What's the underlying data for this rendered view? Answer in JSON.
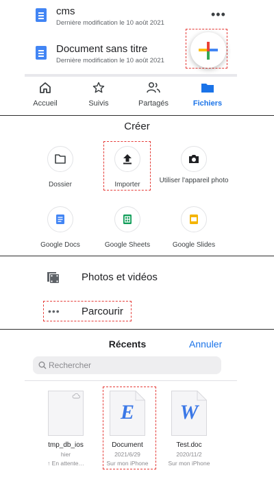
{
  "file_list": {
    "items": [
      {
        "title": "cms",
        "subtitle": "Dernière modification le 10 août 2021"
      },
      {
        "title": "Document sans titre",
        "subtitle": "Dernière modification le 10 août 2021"
      }
    ],
    "more_label": "•••",
    "fab_label": "+"
  },
  "bottom_nav": {
    "items": [
      {
        "label": "Accueil",
        "icon": "home-icon"
      },
      {
        "label": "Suivis",
        "icon": "star-icon"
      },
      {
        "label": "Partagés",
        "icon": "people-icon"
      },
      {
        "label": "Fichiers",
        "icon": "folder-icon"
      }
    ],
    "active_color": "#1a73e8"
  },
  "create_sheet": {
    "title": "Créer",
    "options": [
      {
        "label": "Dossier",
        "icon": "folder-outline-icon"
      },
      {
        "label": "Importer",
        "icon": "upload-icon"
      },
      {
        "label": "Utiliser l'appareil photo",
        "icon": "camera-icon"
      },
      {
        "label": "Google Docs",
        "icon": "google-docs-icon",
        "color": "#4285f4"
      },
      {
        "label": "Google Sheets",
        "icon": "google-sheets-icon",
        "color": "#0f9d58"
      },
      {
        "label": "Google Slides",
        "icon": "google-slides-icon",
        "color": "#f4b400"
      }
    ]
  },
  "picker": {
    "photos_label": "Photos et vidéos",
    "browse_label": "Parcourir"
  },
  "recents": {
    "title": "Récents",
    "cancel_label": "Annuler",
    "search_placeholder": "Rechercher",
    "files": [
      {
        "name": "tmp_db_ios",
        "date": "hier",
        "location": "↑ En attente…"
      },
      {
        "name": "Document",
        "date": "2021/6/29",
        "location": "Sur mon iPhone",
        "glyph": "E"
      },
      {
        "name": "Test.doc",
        "date": "2020/11/2",
        "location": "Sur mon iPhone",
        "glyph": "W"
      }
    ]
  },
  "colors": {
    "accent": "#1a73e8",
    "highlight": "#e53935"
  }
}
